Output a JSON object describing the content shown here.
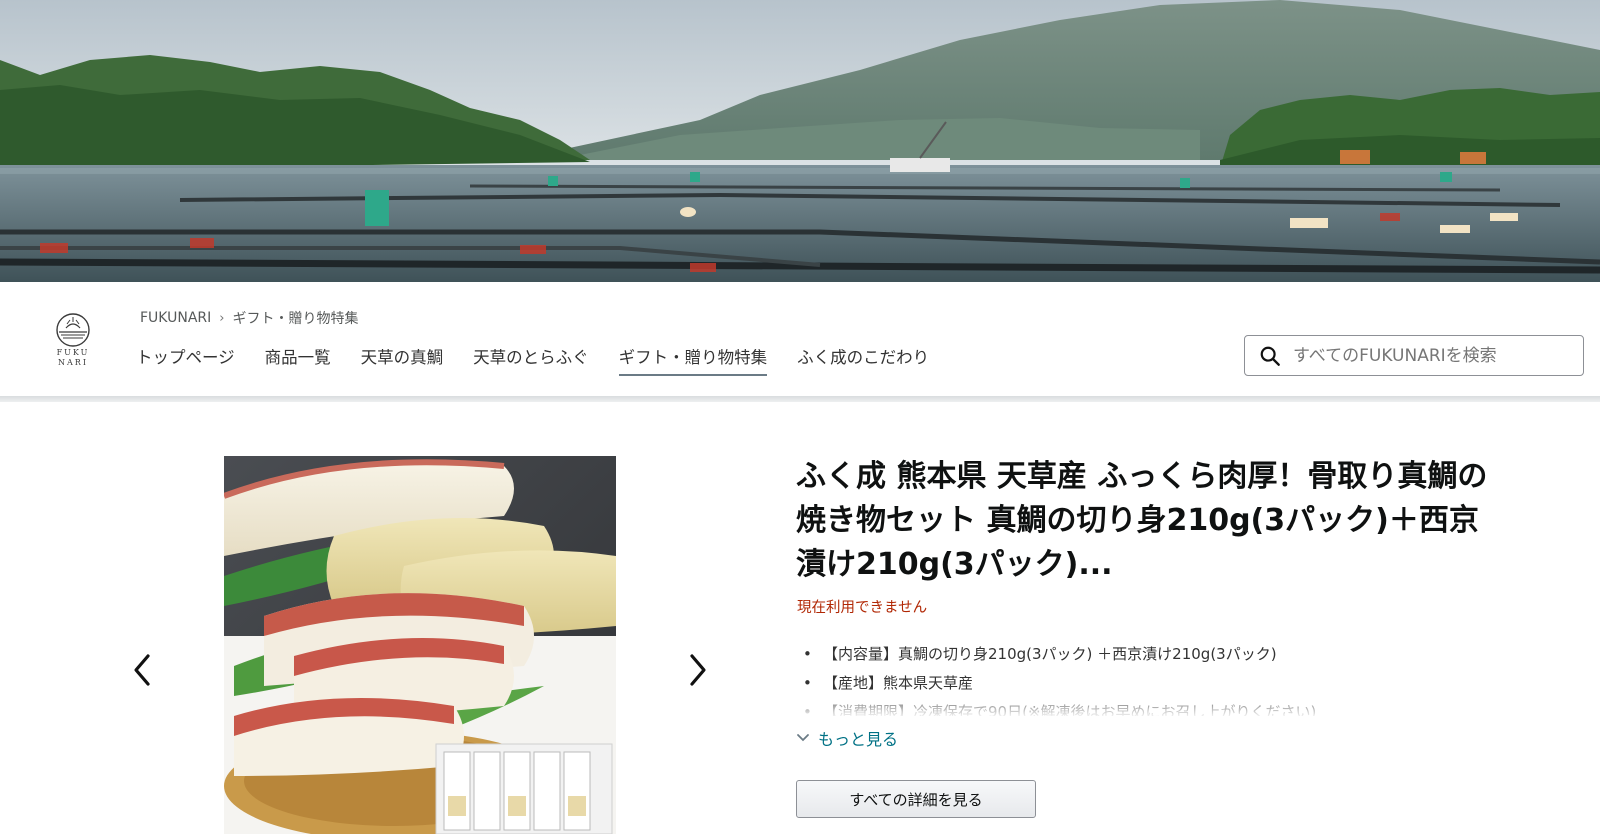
{
  "hero": {
    "alt": "Fish farm cages in Amakusa bay"
  },
  "brand": {
    "logo_text_line1": "FUKU",
    "logo_text_line2": "NARI"
  },
  "breadcrumb": {
    "items": [
      "FUKUNARI",
      "ギフト・贈り物特集"
    ],
    "separator": "›"
  },
  "nav": {
    "items": [
      {
        "label": "トップページ",
        "active": false
      },
      {
        "label": "商品一覧",
        "active": false
      },
      {
        "label": "天草の真鯛",
        "active": false
      },
      {
        "label": "天草のとらふぐ",
        "active": false
      },
      {
        "label": "ギフト・贈り物特集",
        "active": true
      },
      {
        "label": "ふく成のこだわり",
        "active": false
      }
    ]
  },
  "search": {
    "placeholder": "すべてのFUKUNARIを検索",
    "icon": "search-icon"
  },
  "product": {
    "title": "ふく成 熊本県 天草産 ふっくら肉厚！骨取り真鯛の焼き物セット 真鯛の切り身210g(3パック)＋西京漬け210g(3パック)...",
    "availability": "現在利用できません",
    "bullets": [
      "【内容量】真鯛の切り身210g(3パック) ＋西京漬け210g(3パック)",
      "【産地】熊本県天草産",
      "【消費期限】冷凍保存で90日(※解凍後はお早めにお召し上がりください)"
    ],
    "see_more_label": "もっと見る",
    "details_button_label": "すべての詳細を見る"
  },
  "colors": {
    "availability": "#b12704",
    "link": "#007185",
    "nav_underline": "#6b7b86"
  }
}
